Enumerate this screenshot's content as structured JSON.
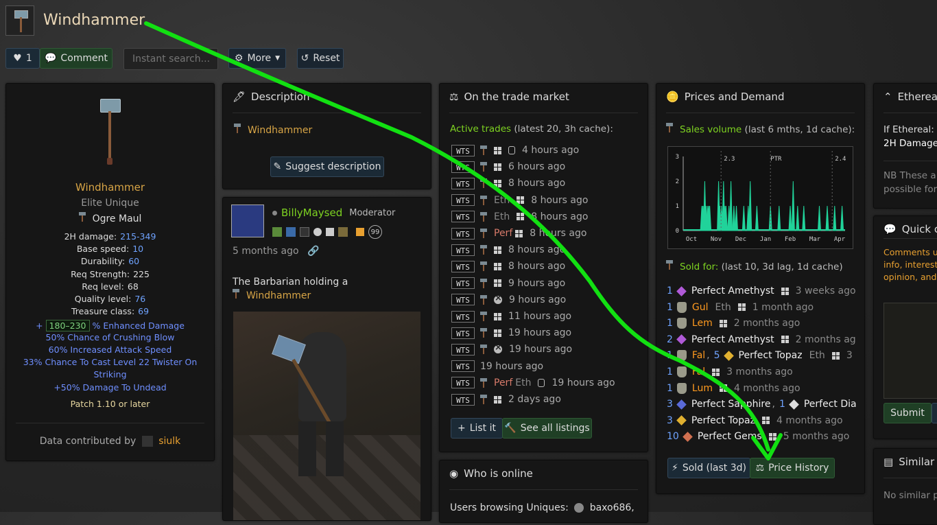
{
  "header": {
    "title": "Windhammer",
    "like_count": "1",
    "comment_label": "Comment",
    "search_placeholder": "Instant search...",
    "more_label": "More",
    "reset_label": "Reset"
  },
  "item": {
    "name": "Windhammer",
    "quality": "Elite Unique",
    "base": "Ogre Maul",
    "stats": [
      {
        "label": "2H damage:",
        "value": "215-349"
      },
      {
        "label": "Base speed:",
        "value": "10"
      },
      {
        "label": "Durability:",
        "value": "60"
      },
      {
        "label": "Req Strength:",
        "value": "225"
      },
      {
        "label": "Req level:",
        "value": "68"
      },
      {
        "label": "Quality level:",
        "value": "76"
      },
      {
        "label": "Treasure class:",
        "value": "69"
      }
    ],
    "ed_prefix": "+",
    "ed_range": "180–230",
    "ed_suffix": "% Enhanced Damage",
    "mods": [
      "50% Chance of Crushing Blow",
      "60% Increased Attack Speed",
      "33% Chance To Cast Level 22 Twister On",
      "Striking",
      "+50% Damage To Undead"
    ],
    "patch": "Patch 1.10 or later",
    "contributed_label": "Data contributed by",
    "contributor": "siulk"
  },
  "description": {
    "title": "Description",
    "item_name": "Windhammer",
    "suggest_label": "Suggest description"
  },
  "post": {
    "username": "BillyMaysed",
    "role": "Moderator",
    "badge_count": "99",
    "time": "5 months ago",
    "text": "The Barbarian holding a",
    "item_name": "Windhammer"
  },
  "trade": {
    "title": "On the trade market",
    "active_label": "Active trades",
    "active_note": "(latest 20, 3h cache):",
    "rows": [
      {
        "tag": "WTS",
        "prefix": "",
        "note": "",
        "plat": "win+switch",
        "time": "4 hours ago"
      },
      {
        "tag": "WTS",
        "prefix": "",
        "note": "",
        "plat": "win",
        "time": "6 hours ago"
      },
      {
        "tag": "WTS",
        "prefix": "",
        "note": "",
        "plat": "win",
        "time": "8 hours ago"
      },
      {
        "tag": "WTS",
        "prefix": "",
        "note": "Eth",
        "plat": "win",
        "time": "8 hours ago"
      },
      {
        "tag": "WTS",
        "prefix": "",
        "note": "Eth",
        "plat": "win",
        "time": "8 hours ago"
      },
      {
        "tag": "WTS",
        "prefix": "Perf",
        "note": "",
        "plat": "win",
        "time": "8 hours ago"
      },
      {
        "tag": "WTS",
        "prefix": "",
        "note": "",
        "plat": "win",
        "time": "8 hours ago"
      },
      {
        "tag": "WTS",
        "prefix": "",
        "note": "",
        "plat": "win",
        "time": "8 hours ago"
      },
      {
        "tag": "WTS",
        "prefix": "",
        "note": "",
        "plat": "win",
        "time": "9 hours ago"
      },
      {
        "tag": "WTS",
        "prefix": "",
        "note": "",
        "plat": "xbox",
        "time": "9 hours ago"
      },
      {
        "tag": "WTS",
        "prefix": "",
        "note": "",
        "plat": "win",
        "time": "11 hours ago"
      },
      {
        "tag": "WTS",
        "prefix": "",
        "note": "",
        "plat": "win",
        "time": "19 hours ago"
      },
      {
        "tag": "WTS",
        "prefix": "",
        "note": "",
        "plat": "xbox",
        "time": "19 hours ago"
      },
      {
        "tag": "WTS",
        "prefix": "",
        "note": "",
        "plat": "none",
        "time": "19 hours ago"
      },
      {
        "tag": "WTS",
        "prefix": "Perf",
        "note": "Eth",
        "plat": "switch",
        "time": "19 hours ago"
      },
      {
        "tag": "WTS",
        "prefix": "",
        "note": "",
        "plat": "win",
        "time": "2 days ago"
      }
    ],
    "list_it_label": "List it",
    "see_all_label": "See all listings"
  },
  "online": {
    "title": "Who is online",
    "text": "Users browsing Uniques:",
    "user": "baxo686,"
  },
  "prices": {
    "title": "Prices and Demand",
    "sales_label": "Sales volume",
    "sales_note": "(last 6 mths, 1d cache):",
    "chart_labels": {
      "ptr": "PTR",
      "v1": "2.3",
      "v2": "2.4"
    },
    "sold_label": "Sold for:",
    "sold_note": "(last 10, 3d lag, 1d cache)",
    "sold_rows": [
      {
        "parts": [
          {
            "q": "1",
            "gem": "#b05ad8",
            "name": "Perfect Amethyst",
            "cls": ""
          }
        ],
        "plat": "win",
        "eth": "",
        "time": "3 weeks ago"
      },
      {
        "parts": [
          {
            "q": "1",
            "rune": true,
            "name": "Gul",
            "cls": "orange"
          }
        ],
        "plat": "win",
        "eth": "Eth",
        "time": "1 month ago"
      },
      {
        "parts": [
          {
            "q": "1",
            "rune": true,
            "name": "Lem",
            "cls": "orange"
          }
        ],
        "plat": "win",
        "eth": "",
        "time": "2 months ago"
      },
      {
        "parts": [
          {
            "q": "2",
            "gem": "#b05ad8",
            "name": "Perfect Amethyst",
            "cls": ""
          }
        ],
        "plat": "win",
        "eth": "",
        "time": "2 months ag"
      },
      {
        "parts": [
          {
            "q": "1",
            "rune": true,
            "name": "Fal",
            "cls": "orange"
          },
          {
            "q": "5",
            "gem": "#e0b030",
            "name": "Perfect Topaz",
            "cls": ""
          }
        ],
        "plat": "win",
        "eth": "Eth",
        "time": "3"
      },
      {
        "parts": [
          {
            "q": "1",
            "rune": true,
            "name": "Fal",
            "cls": "orange"
          }
        ],
        "plat": "win",
        "eth": "",
        "time": "3 months ago"
      },
      {
        "parts": [
          {
            "q": "1",
            "rune": true,
            "name": "Lum",
            "cls": "orange"
          }
        ],
        "plat": "win",
        "eth": "",
        "time": "4 months ago"
      },
      {
        "parts": [
          {
            "q": "3",
            "gem": "#5a6ad8",
            "name": "Perfect Sapphire",
            "cls": ""
          },
          {
            "q": "1",
            "gem": "#dddddd",
            "name": "Perfect Dia",
            "cls": ""
          }
        ],
        "plat": "",
        "eth": "",
        "time": ""
      },
      {
        "parts": [
          {
            "q": "3",
            "gem": "#e0b030",
            "name": "Perfect Topaz",
            "cls": ""
          }
        ],
        "plat": "win",
        "eth": "",
        "time": "4 months ago"
      },
      {
        "parts": [
          {
            "q": "10",
            "gem": "#d07050",
            "name": "Perfect Gems",
            "cls": ""
          }
        ],
        "plat": "win",
        "eth": "",
        "time": "5 months ago"
      }
    ],
    "sold_btn_label": "Sold (last 3d)",
    "history_btn_label": "Price History",
    "chart_data": {
      "type": "bar",
      "x": [
        "Oct",
        "Nov",
        "Dec",
        "Jan",
        "Feb",
        "Mar",
        "Apr"
      ],
      "ylim": [
        0,
        3
      ],
      "yticks": [
        "0",
        "1",
        "2",
        "3"
      ],
      "spikes": [
        [
          0.42,
          1
        ],
        [
          0.46,
          1
        ],
        [
          0.5,
          1
        ],
        [
          0.54,
          2
        ],
        [
          0.6,
          1
        ],
        [
          0.66,
          1
        ],
        [
          0.7,
          1
        ],
        [
          0.74,
          1
        ],
        [
          1.1,
          2
        ],
        [
          1.15,
          1
        ],
        [
          1.22,
          1
        ],
        [
          1.3,
          2
        ],
        [
          1.36,
          1
        ],
        [
          1.4,
          1
        ],
        [
          1.52,
          1
        ],
        [
          1.6,
          2
        ],
        [
          1.72,
          1
        ],
        [
          1.82,
          1
        ],
        [
          2.12,
          1
        ],
        [
          2.3,
          1
        ],
        [
          2.38,
          2
        ],
        [
          2.65,
          1
        ],
        [
          3.2,
          1
        ],
        [
          3.55,
          1
        ],
        [
          4.0,
          1
        ],
        [
          4.12,
          2
        ],
        [
          4.3,
          1
        ],
        [
          4.55,
          1
        ],
        [
          5.18,
          1
        ],
        [
          5.5,
          1
        ],
        [
          5.8,
          1
        ],
        [
          6.1,
          1
        ]
      ]
    }
  },
  "ethereal": {
    "title": "Ethereal",
    "line1": "If Ethereal:",
    "line2": "2H Damage",
    "nb1": "NB These a",
    "nb2": "possible for"
  },
  "quick": {
    "title": "Quick c",
    "l1": "Comments us",
    "l2": "info, interesti",
    "l3": "opinion, and",
    "submit": "Submit"
  },
  "similar": {
    "title": "Similar",
    "text": "No similar p"
  },
  "colors": {
    "accent_green": "#00ff00",
    "gold": "#d8a546",
    "magic": "#6f8fff",
    "rune_orange": "#ff9a1f"
  }
}
